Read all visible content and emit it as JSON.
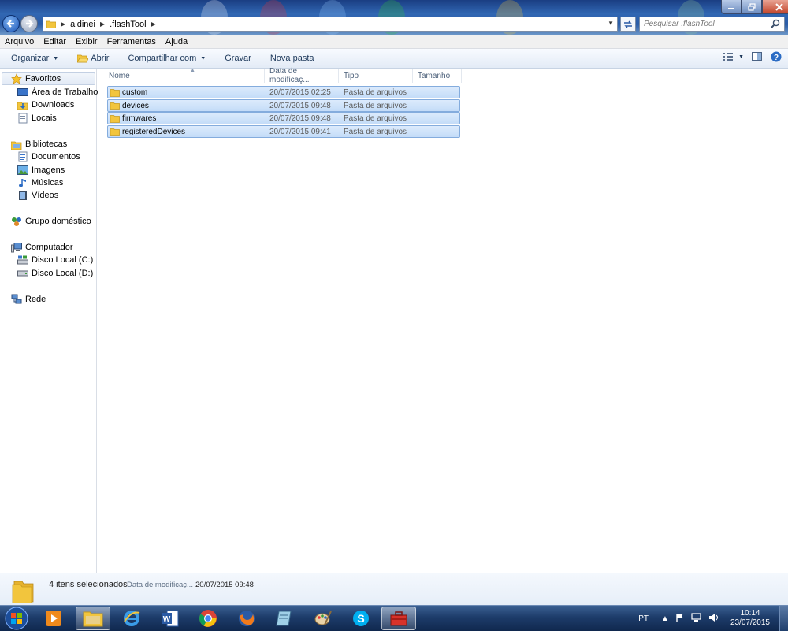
{
  "window": {
    "controls": [
      "minimize-icon",
      "maximize-icon",
      "close-icon"
    ]
  },
  "address": {
    "segments": [
      "aldinei",
      ".flashTool"
    ]
  },
  "search": {
    "placeholder": "Pesquisar .flashTool"
  },
  "menu": {
    "items": [
      "Arquivo",
      "Editar",
      "Exibir",
      "Ferramentas",
      "Ajuda"
    ]
  },
  "toolbar": {
    "organize": "Organizar",
    "open": "Abrir",
    "share": "Compartilhar com",
    "burn": "Gravar",
    "new_folder": "Nova pasta"
  },
  "sidebar": {
    "favorites": "Favoritos",
    "desktop": "Área de Trabalho",
    "downloads": "Downloads",
    "places": "Locais",
    "libraries": "Bibliotecas",
    "documents": "Documentos",
    "images": "Imagens",
    "music": "Músicas",
    "videos": "Vídeos",
    "homegroup": "Grupo doméstico",
    "computer": "Computador",
    "disk_c": "Disco Local (C:)",
    "disk_d": "Disco Local (D:)",
    "network": "Rede"
  },
  "columns": {
    "name": "Nome",
    "date": "Data de modificaç...",
    "type": "Tipo",
    "size": "Tamanho"
  },
  "files": [
    {
      "name": "custom",
      "date": "20/07/2015 02:25",
      "type": "Pasta de arquivos"
    },
    {
      "name": "devices",
      "date": "20/07/2015 09:48",
      "type": "Pasta de arquivos"
    },
    {
      "name": "firmwares",
      "date": "20/07/2015 09:48",
      "type": "Pasta de arquivos"
    },
    {
      "name": "registeredDevices",
      "date": "20/07/2015 09:41",
      "type": "Pasta de arquivos"
    }
  ],
  "details": {
    "selected": "4 itens selecionados",
    "date_label": "Data de modificaç...",
    "date_value": "20/07/2015 09:48"
  },
  "taskbar": {
    "language": "PT",
    "time": "10:14",
    "date": "23/07/2015"
  },
  "colors": {
    "selection_fill": "#cde3fb",
    "selection_border": "#84acdd",
    "taskbar": "#1d3c6a",
    "folder": "#f2c53d"
  }
}
